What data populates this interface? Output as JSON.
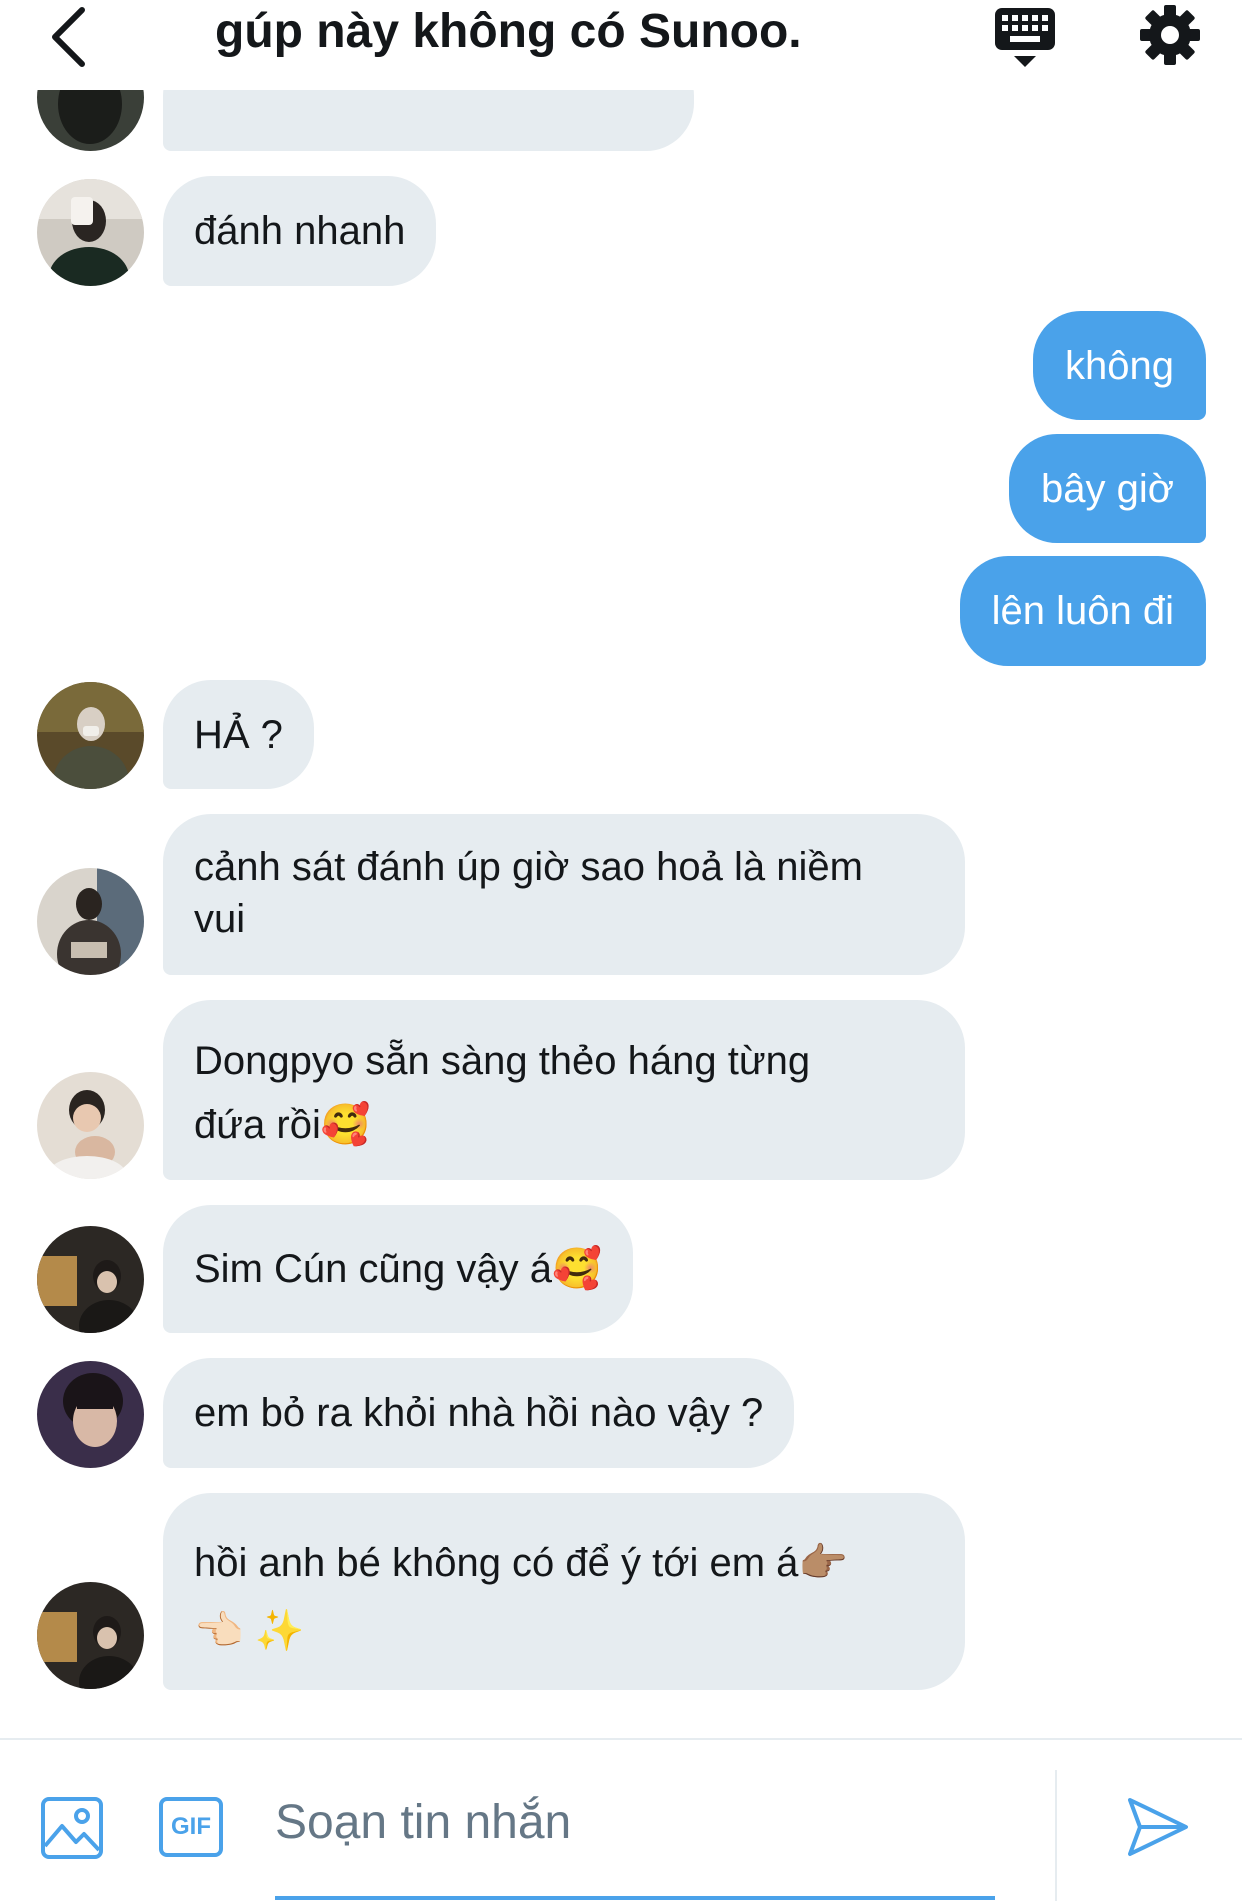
{
  "header": {
    "title": "gúp này không có Sunoo.",
    "back_icon": "chevron-left-icon",
    "keyboard_icon": "keyboard-icon",
    "settings_icon": "gear-icon"
  },
  "colors": {
    "accent": "#4aa2ea",
    "incoming_bubble": "#e6ecf0",
    "text": "#14171a",
    "placeholder": "#657786"
  },
  "messages": [
    {
      "direction": "in",
      "lines": [
        "đánh nhanh"
      ]
    },
    {
      "direction": "out",
      "lines": [
        "không"
      ]
    },
    {
      "direction": "out",
      "lines": [
        "bây giờ"
      ]
    },
    {
      "direction": "out",
      "lines": [
        "lên luôn đi"
      ]
    },
    {
      "direction": "in",
      "lines": [
        "HẢ ?"
      ]
    },
    {
      "direction": "in",
      "lines": [
        "cảnh sát đánh úp giờ sao hoả là niềm",
        "vui"
      ]
    },
    {
      "direction": "in",
      "lines": [
        "Dongpyo sẵn sàng thẻo háng từng",
        "đứa rồi🥰"
      ]
    },
    {
      "direction": "in",
      "lines": [
        "Sim Cún cũng vậy á🥰"
      ]
    },
    {
      "direction": "in",
      "lines": [
        "em bỏ ra khỏi nhà hồi nào vậy ?"
      ]
    },
    {
      "direction": "in",
      "lines": [
        "hồi anh bé không có để ý tới em á👉🏽",
        "👈🏻 ✨"
      ]
    }
  ],
  "composer": {
    "placeholder": "Soạn tin nhắn",
    "photo_icon": "image-icon",
    "gif_label": "GIF",
    "send_icon": "send-icon"
  }
}
